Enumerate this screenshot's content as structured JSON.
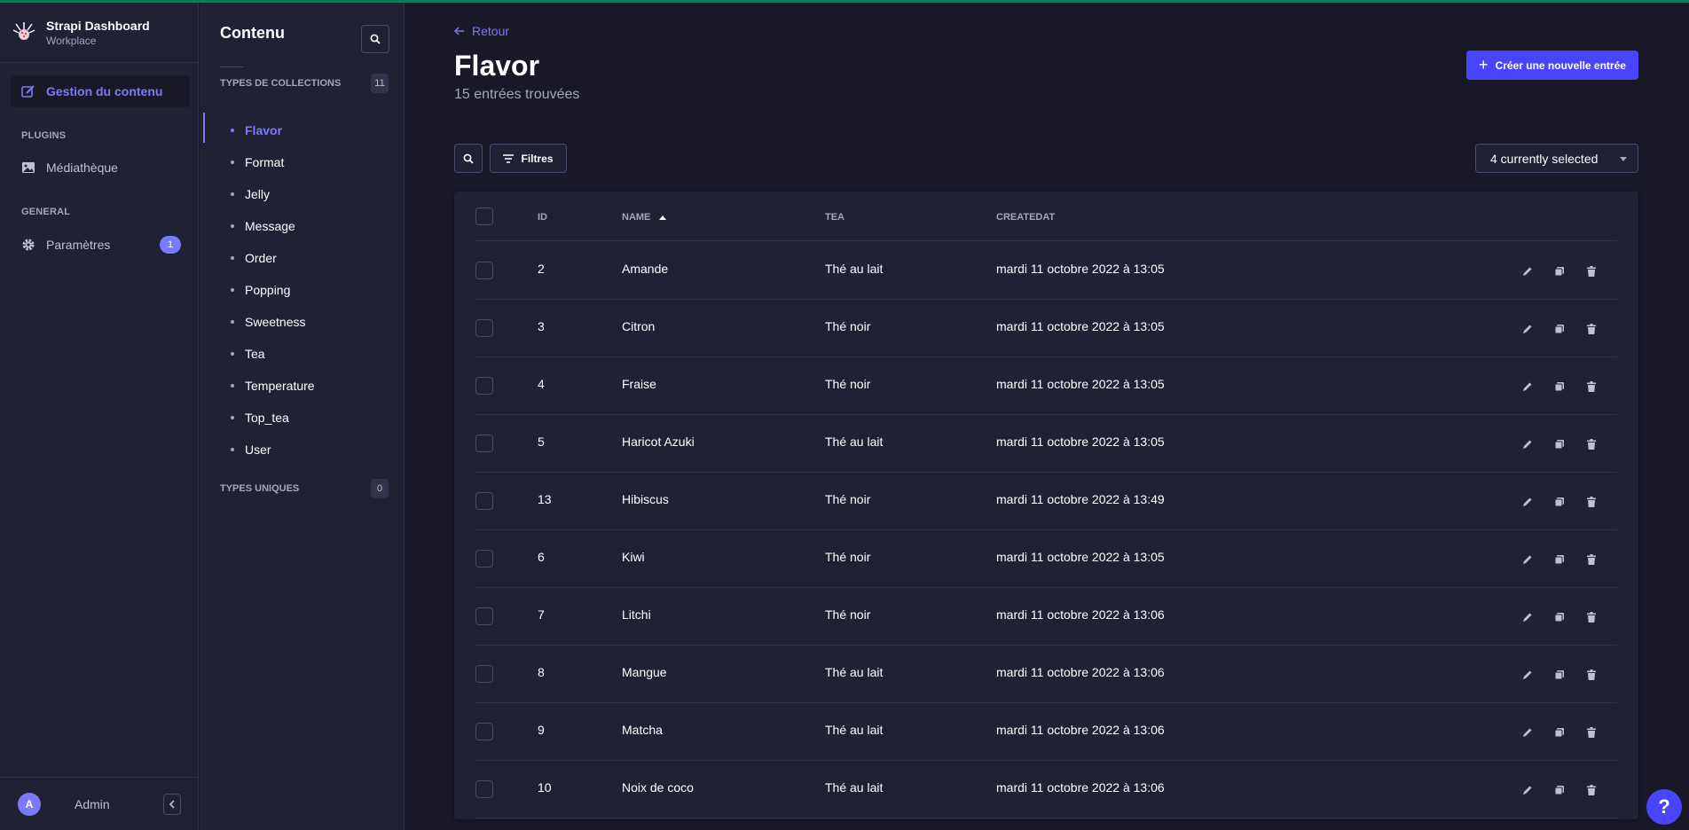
{
  "brand": {
    "title": "Strapi Dashboard",
    "subtitle": "Workplace"
  },
  "mainnav": {
    "active_item": "Gestion du contenu",
    "plugins_label": "PLUGINS",
    "media_label": "Médiathèque",
    "general_label": "GENERAL",
    "settings_label": "Paramètres",
    "settings_badge": "1",
    "user_initial": "A",
    "user_name": "Admin"
  },
  "subnav": {
    "title": "Contenu",
    "collections_label": "TYPES DE COLLECTIONS",
    "collections_count": "11",
    "collections": [
      "Flavor",
      "Format",
      "Jelly",
      "Message",
      "Order",
      "Popping",
      "Sweetness",
      "Tea",
      "Temperature",
      "Top_tea",
      "User"
    ],
    "singles_label": "TYPES UNIQUES",
    "singles_count": "0"
  },
  "header": {
    "back_label": "Retour",
    "title": "Flavor",
    "subtitle": "15 entrées trouvées",
    "create_label": "Créer une nouvelle entrée"
  },
  "toolbar": {
    "filters_label": "Filtres",
    "columns_label": "4 currently selected"
  },
  "table": {
    "columns": [
      "ID",
      "NAME",
      "TEA",
      "CREATEDAT"
    ],
    "rows": [
      {
        "id": "2",
        "name": "Amande",
        "tea": "Thé au lait",
        "createdat": "mardi 11 octobre 2022 à 13:05"
      },
      {
        "id": "3",
        "name": "Citron",
        "tea": "Thé noir",
        "createdat": "mardi 11 octobre 2022 à 13:05"
      },
      {
        "id": "4",
        "name": "Fraise",
        "tea": "Thé noir",
        "createdat": "mardi 11 octobre 2022 à 13:05"
      },
      {
        "id": "5",
        "name": "Haricot Azuki",
        "tea": "Thé au lait",
        "createdat": "mardi 11 octobre 2022 à 13:05"
      },
      {
        "id": "13",
        "name": "Hibiscus",
        "tea": "Thé noir",
        "createdat": "mardi 11 octobre 2022 à 13:49"
      },
      {
        "id": "6",
        "name": "Kiwi",
        "tea": "Thé noir",
        "createdat": "mardi 11 octobre 2022 à 13:05"
      },
      {
        "id": "7",
        "name": "Litchi",
        "tea": "Thé noir",
        "createdat": "mardi 11 octobre 2022 à 13:06"
      },
      {
        "id": "8",
        "name": "Mangue",
        "tea": "Thé au lait",
        "createdat": "mardi 11 octobre 2022 à 13:06"
      },
      {
        "id": "9",
        "name": "Matcha",
        "tea": "Thé au lait",
        "createdat": "mardi 11 octobre 2022 à 13:06"
      },
      {
        "id": "10",
        "name": "Noix de coco",
        "tea": "Thé au lait",
        "createdat": "mardi 11 octobre 2022 à 13:06"
      }
    ]
  },
  "help_label": "?",
  "colors": {
    "accent": "#7b79ff",
    "primary": "#4945ff",
    "bg": "#181826",
    "panel": "#212134"
  }
}
